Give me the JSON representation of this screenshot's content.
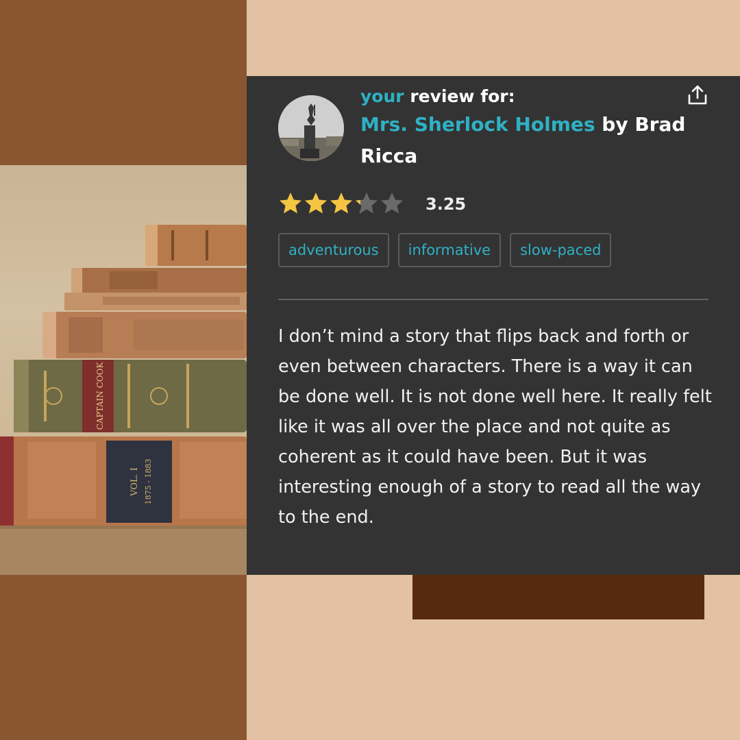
{
  "review": {
    "heading_your": "your",
    "heading_review_for": "review for:",
    "book_title": "Mrs. Sherlock Holmes",
    "book_author": "by Brad Ricca",
    "rating_value": "3.25",
    "rating_stars": 3.25,
    "rating_max": 5,
    "tags": [
      "adventurous",
      "informative",
      "slow-paced"
    ],
    "text": "I don’t mind a story that flips back and forth or even between characters. There is a way it can be done well. It is not done well here. It really felt like it was all over the place and not quite as coherent as it could have been. But it was interesting enough of a story to read all the way to the end."
  },
  "photo": {
    "spine_text_1": "CAPTAIN COOK",
    "spine_text_2": "VOL. I",
    "spine_text_3": "1875 - 1883"
  },
  "colors": {
    "accent": "#2fb1c4",
    "card_bg": "#333333",
    "page_bg": "#e2c2a2",
    "brown": "#8a5631",
    "dark_brown": "#57290e",
    "star_filled": "#f5c542",
    "star_empty": "#6a6a6a"
  },
  "icons": {
    "share": "share-icon",
    "star": "star-icon"
  }
}
